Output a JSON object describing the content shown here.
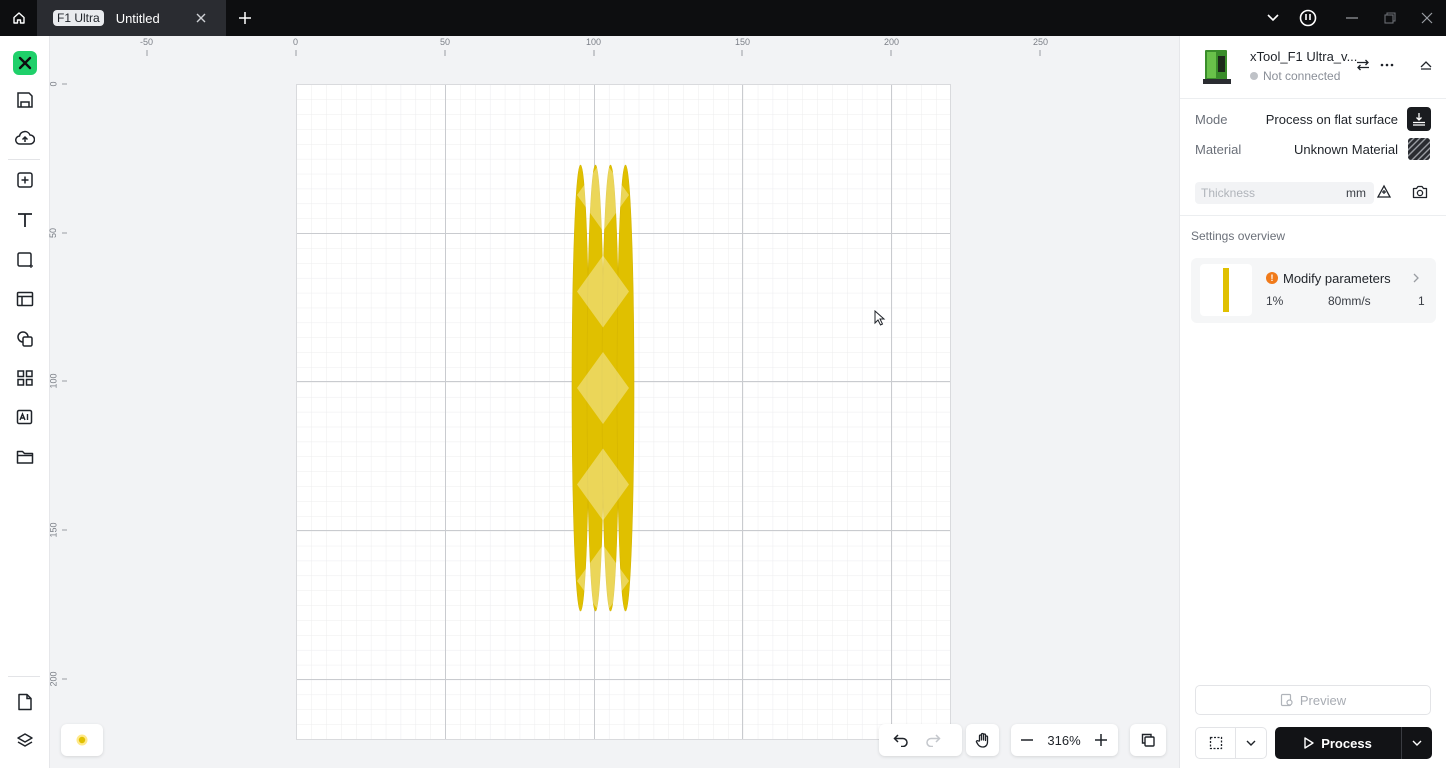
{
  "titlebar": {
    "tab_badge": "F1 Ultra",
    "tab_title": "Untitled"
  },
  "ruler": {
    "top_ticks": [
      "-50",
      "0",
      "50",
      "100",
      "150",
      "200",
      "250"
    ],
    "left_ticks": [
      "0",
      "50",
      "100",
      "150",
      "200"
    ]
  },
  "canvas": {
    "zoom": "316%",
    "shape_color": "#e0c000"
  },
  "device": {
    "name": "xTool_F1 Ultra_v...",
    "status": "Not connected"
  },
  "settings": {
    "mode_label": "Mode",
    "mode_value": "Process on flat surface",
    "material_label": "Material",
    "material_value": "Unknown Material",
    "thickness_placeholder": "Thickness",
    "thickness_unit": "mm",
    "overview_title": "Settings overview",
    "card_title": "Modify parameters",
    "power": "1%",
    "speed": "80mm/s",
    "passes": "1"
  },
  "actions": {
    "preview": "Preview",
    "process": "Process"
  },
  "colors": {
    "accent": "#1fd06a",
    "shape": "#e0c000",
    "warning": "#f07a1a"
  }
}
